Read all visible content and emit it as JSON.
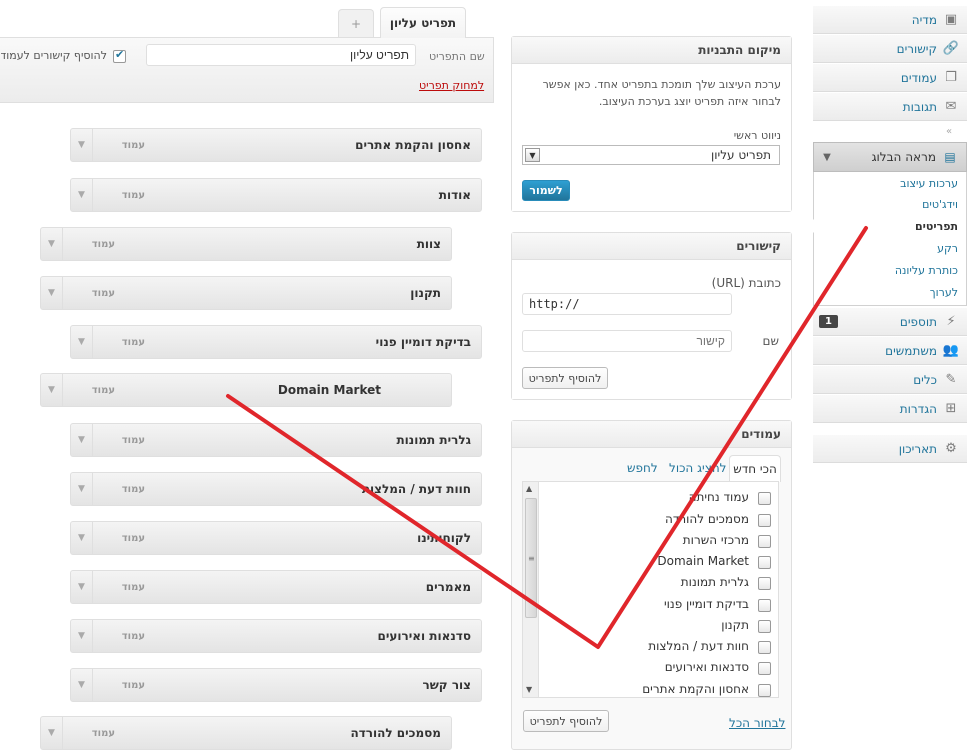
{
  "admin_menu": {
    "top_items": [
      {
        "label": "מדיה",
        "icon": "media-icon"
      },
      {
        "label": "קישורים",
        "icon": "links-icon"
      },
      {
        "label": "עמודים",
        "icon": "pages-icon"
      },
      {
        "label": "תגובות",
        "icon": "comments-icon"
      }
    ],
    "appearance": {
      "label": "מראה הבלוג",
      "submenu": [
        "ערכות עיצוב",
        "וידג'טים",
        "תפריטים",
        "רקע",
        "כותרת עליונה",
        "לערוך"
      ]
    },
    "bottom_items": [
      {
        "label": "תוספים",
        "icon": "plugins-icon",
        "count": "1"
      },
      {
        "label": "משתמשים",
        "icon": "users-icon"
      },
      {
        "label": "כלים",
        "icon": "tools-icon"
      },
      {
        "label": "הגדרות",
        "icon": "settings-icon"
      }
    ],
    "dashboard": {
      "label": "תאריכון",
      "icon": "dashboard-icon"
    }
  },
  "theme_locations": {
    "title": "מיקום התבניות",
    "description_line1": "ערכת העיצוב שלך תומכת בתפריט אחד. כאן אפשר",
    "description_line2": "לבחור איזה תפריט יוצג בערכת העיצוב.",
    "primary_label": "ניווט ראשי",
    "primary_selected": "תפריט עליון",
    "save_label": "לשמור"
  },
  "links_box": {
    "title": "קישורים",
    "url_label": "כתובת (URL)",
    "url_value": "http://",
    "name_label": "שם",
    "name_placeholder": "קישור",
    "add_label": "להוסיף לתפריט"
  },
  "pages_box": {
    "title": "עמודים",
    "tabs": [
      "הכי חדש",
      "להציג הכול",
      "לחפש"
    ],
    "items": [
      "עמוד נחיתה",
      "מסמכים להורדה",
      "מרכזי השרות",
      "Domain Market",
      "גלרית תמונות",
      "בדיקת דומיין פנוי",
      "תקנון",
      "חוות דעת / המלצות",
      "סדנאות ואירועים",
      "אחסון והקמת אתרים"
    ],
    "select_all": "לבחור הכל",
    "add_label": "להוסיף לתפריט"
  },
  "menu_editor": {
    "active_tab": "תפריט עליון",
    "add_tab": "+",
    "menu_name_label": "שם התפריט",
    "menu_name_value": "תפריט עליון",
    "auto_add_label": "להוסיף קישורים לעמודים",
    "delete_label": "למחוק תפריט",
    "item_type": "עמוד",
    "items": [
      {
        "title": "אחסון והקמת אתרים",
        "depth": 1
      },
      {
        "title": "אודות",
        "depth": 1
      },
      {
        "title": "צוות",
        "depth": 0
      },
      {
        "title": "תקנון",
        "depth": 0
      },
      {
        "title": "בדיקת דומיין פנוי",
        "depth": 1
      },
      {
        "title": "Domain Market",
        "depth": 0
      },
      {
        "title": "גלרית תמונות",
        "depth": 1
      },
      {
        "title": "חוות דעת / המלצות",
        "depth": 1
      },
      {
        "title": "לקוחותינו",
        "depth": 1
      },
      {
        "title": "מאמרים",
        "depth": 1
      },
      {
        "title": "סדנאות ואירועים",
        "depth": 1
      },
      {
        "title": "צור קשר",
        "depth": 1
      },
      {
        "title": "מסמכים להורדה",
        "depth": 0
      }
    ]
  },
  "colors": {
    "link": "#21759b",
    "annotation": "#e0262b",
    "delete": "#bc0b0b"
  }
}
